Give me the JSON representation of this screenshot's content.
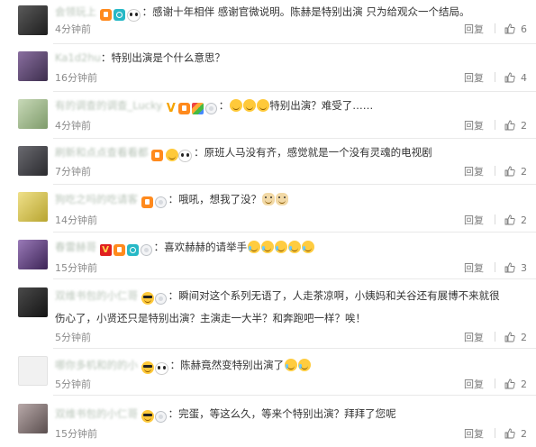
{
  "colors": {
    "text": "#333333",
    "meta": "#8b8b8b",
    "separator": "#e9e9e9"
  },
  "comments": [
    {
      "avatar_color": "#3b3b3b",
      "badges": [
        "vip",
        "cam",
        "panda"
      ],
      "separator": "：",
      "text": "感谢十年相伴 感谢官微说明。陈赫是特别出演 只为给观众一个结局。",
      "emojis_after": [],
      "time": "4分钟前",
      "reply": "回复",
      "likes": "6",
      "thumb_icon": "thumbs-up-icon"
    },
    {
      "avatar_color": "#5d4a6b",
      "badges": [],
      "separator": "：",
      "text": "特别出演是个什么意思？",
      "emojis_after": [],
      "time": "16分钟前",
      "reply": "回复",
      "likes": "4",
      "thumb_icon": "thumbs-up-icon"
    },
    {
      "avatar_color": "#9fb58e",
      "badges": [
        "v",
        "vip",
        "mosaic",
        "ring"
      ],
      "separator": "：",
      "text": "特别出演？难受了……",
      "emojis_before": [
        "grin",
        "grin",
        "grin"
      ],
      "time": "4分钟前",
      "reply": "回复",
      "likes": "2",
      "thumb_icon": "thumbs-up-icon"
    },
    {
      "avatar_color": "#46464a",
      "badges": [
        "vip",
        "grin",
        "panda"
      ],
      "separator": "：",
      "text": "原班人马没有齐，感觉就是一个没有灵魂的电视剧",
      "emojis_after": [],
      "time": "7分钟前",
      "reply": "回复",
      "likes": "2",
      "thumb_icon": "thumbs-up-icon"
    },
    {
      "avatar_color": "#d8c85a",
      "badges": [
        "vip",
        "ring"
      ],
      "separator": "：",
      "text": "哦吼，想我了没？",
      "emojis_after": [
        "doge",
        "doge"
      ],
      "time": "14分钟前",
      "reply": "回复",
      "likes": "2",
      "thumb_icon": "thumbs-up-icon"
    },
    {
      "avatar_color": "#6b4a8a",
      "badges": [
        "vred",
        "vip",
        "cam",
        "ring"
      ],
      "separator": "：",
      "text": "喜欢赫赫的请举手",
      "emojis_after": [
        "cry",
        "cry",
        "cry",
        "cry",
        "cry"
      ],
      "time": "15分钟前",
      "reply": "回复",
      "likes": "3",
      "thumb_icon": "thumbs-up-icon"
    },
    {
      "avatar_color": "#2c2c2c",
      "badges": [
        "cool",
        "ring"
      ],
      "separator": "：",
      "text": "瞬间对这个系列无语了，人走茶凉啊，小姨妈和关谷还有展博不来就很",
      "text2": "伤心了，小贤还只是特别出演？主演走一大半？和奔跑吧一样？唉！",
      "emojis_after": [],
      "time": "5分钟前",
      "reply": "回复",
      "likes": "2",
      "thumb_icon": "thumbs-up-icon"
    },
    {
      "avatar_color": "#eeeeee",
      "badges": [
        "cool",
        "panda"
      ],
      "separator": "：",
      "text": "陈赫竟然变特别出演了",
      "emojis_after": [
        "cry",
        "cry"
      ],
      "time": "5分钟前",
      "reply": "回复",
      "likes": "2",
      "thumb_icon": "thumbs-up-icon"
    },
    {
      "avatar_color": "#8a7d7d",
      "badges": [
        "cool",
        "ring"
      ],
      "separator": "：",
      "text": "完蛋，等这么久，等来个特别出演？拜拜了您呢",
      "emojis_after": [],
      "time": "15分钟前",
      "reply": "回复",
      "likes": "2",
      "thumb_icon": "thumbs-up-icon"
    }
  ]
}
